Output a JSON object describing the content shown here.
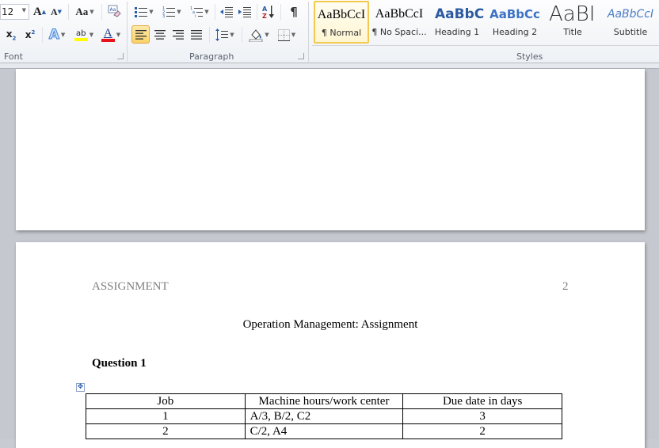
{
  "ribbon": {
    "font_group": {
      "label": "Font",
      "font_size": "12",
      "grow_font": "A",
      "shrink_font": "A",
      "change_case": "Aa",
      "subscript": "x",
      "superscript": "x",
      "text_effects": "A",
      "highlight": "ab",
      "font_color": "A",
      "highlight_color": "#ffff00",
      "font_color_value": "#e8121b"
    },
    "paragraph_group": {
      "label": "Paragraph",
      "pilcrow": "¶"
    },
    "styles_group": {
      "label": "Styles",
      "items": [
        {
          "sample": "AaBbCcI",
          "name": "¶ Normal",
          "selected": true
        },
        {
          "sample": "AaBbCcI",
          "name": "¶ No Spaci...",
          "selected": false
        },
        {
          "sample": "AaBbC",
          "name": "Heading 1",
          "selected": false
        },
        {
          "sample": "AaBbCc",
          "name": "Heading 2",
          "selected": false
        },
        {
          "sample": "AaBI",
          "name": "Title",
          "selected": false
        },
        {
          "sample": "AaBbCcI",
          "name": "Subtitle",
          "selected": false
        }
      ]
    }
  },
  "document": {
    "page2": {
      "running_head": "ASSIGNMENT",
      "page_number": "2",
      "title": "Operation Management: Assignment",
      "question_heading": "Question 1",
      "table": {
        "headers": [
          "Job",
          "Machine hours/work center",
          "Due date in days"
        ],
        "rows": [
          [
            "1",
            "A/3, B/2, C2",
            "3"
          ],
          [
            "2",
            "C/2, A4",
            "2"
          ]
        ]
      }
    }
  }
}
